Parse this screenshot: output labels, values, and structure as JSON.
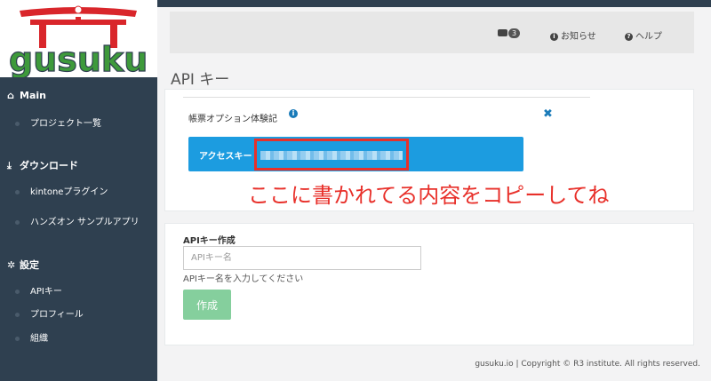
{
  "brand": {
    "logo_text": "gusuku"
  },
  "sidebar": {
    "sections": [
      {
        "label": "Main",
        "items": [
          {
            "label": "プロジェクト一覧"
          }
        ]
      },
      {
        "label": "ダウンロード",
        "items": [
          {
            "label": "kintoneプラグイン"
          },
          {
            "label": "ハンズオン サンプルアプリ"
          }
        ]
      },
      {
        "label": "設定",
        "items": [
          {
            "label": "APIキー"
          },
          {
            "label": "プロフィール"
          },
          {
            "label": "組織"
          }
        ]
      }
    ]
  },
  "navbar": {
    "inbox_count": "3",
    "notice_label": "お知らせ",
    "help_label": "ヘルプ"
  },
  "page": {
    "title": "API キー"
  },
  "api_key_card": {
    "title": "帳票オプション体験記",
    "access_key_label": "アクセスキー"
  },
  "annotation": {
    "text": "ここに書かれてる内容をコピーしてね"
  },
  "create_form": {
    "section_label": "APIキー作成",
    "input_placeholder": "APIキー名",
    "help_text": "APIキー名を入力してください",
    "submit_label": "作成"
  },
  "footer": {
    "text": "gusuku.io | Copyright © R3 institute. All rights reserved."
  },
  "colors": {
    "sidebar_bg": "#2f4050",
    "accent_blue": "#1c9ce0",
    "annotation_red": "#e8302a",
    "button_green": "#85cf9d"
  }
}
